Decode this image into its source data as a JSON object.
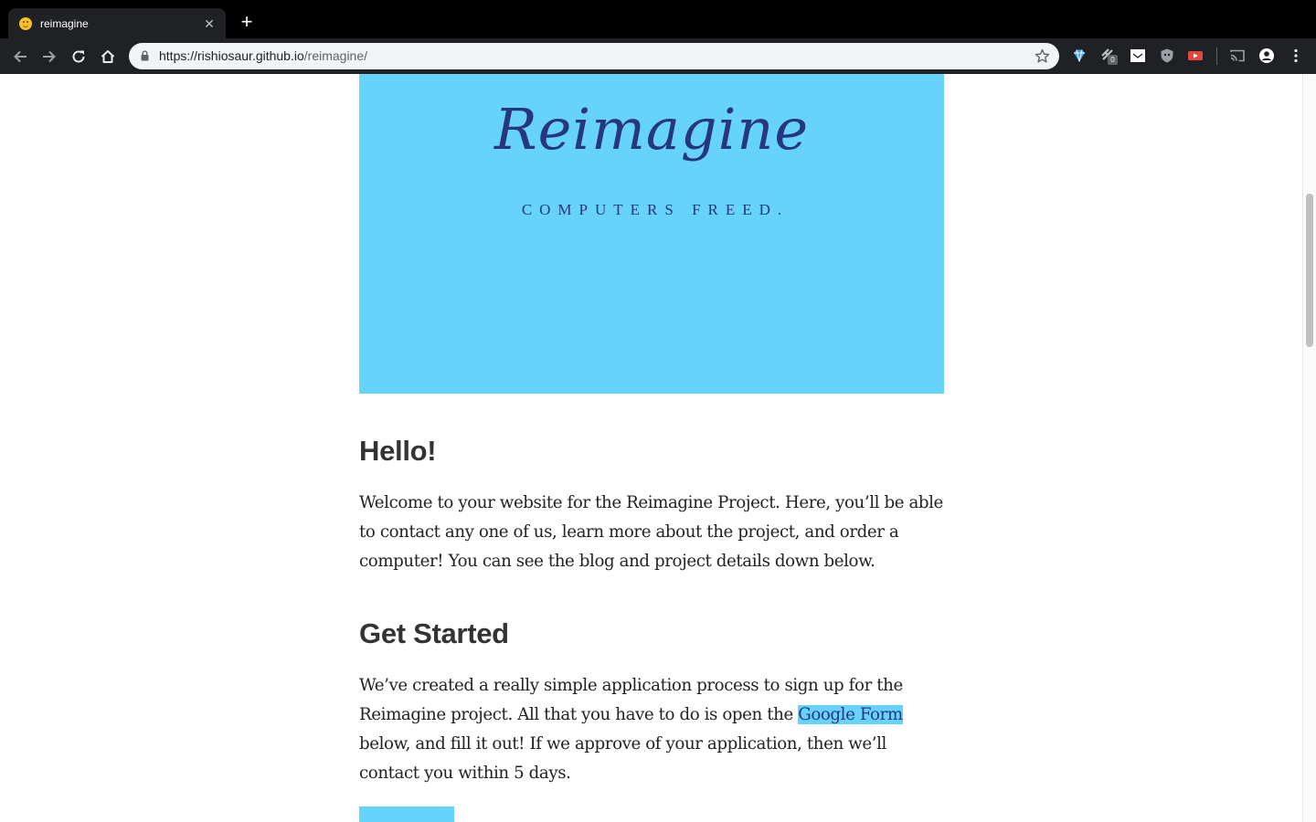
{
  "browser": {
    "tab_title": "reimagine",
    "url_host": "https://rishiosaur.github.io",
    "url_path": "/reimagine/",
    "extension_badge": "0",
    "colors": {
      "frame": "#000000",
      "toolbar": "#202124",
      "omnibox": "#f1f3f4"
    },
    "icons": [
      "back-icon",
      "forward-icon",
      "reload-icon",
      "home-icon",
      "lock-icon",
      "bookmark-star-icon",
      "cast-icon",
      "profile-icon",
      "menu-icon"
    ]
  },
  "hero": {
    "title": "Reimagine",
    "tagline": "COMPUTERS FREED.",
    "background": "#66d3fd",
    "text_color": "#273583"
  },
  "sections": {
    "hello": {
      "heading": "Hello!",
      "body": "Welcome to your website for the Reimagine Project. Here, you’ll be able to contact any one of us, learn more about the project, and order a computer! You can see the blog and project details down below."
    },
    "get_started": {
      "heading": "Get Started",
      "body_before_link": "We’ve created a really simple application process to sign up for the Reimagine project. All that you have to do is open the ",
      "link_text": "Google Form",
      "body_after_link": " below, and fill it out! If we approve of your application, then we’ll contact you within 5 days."
    }
  },
  "scroll": {
    "position_fraction": 0.16
  }
}
